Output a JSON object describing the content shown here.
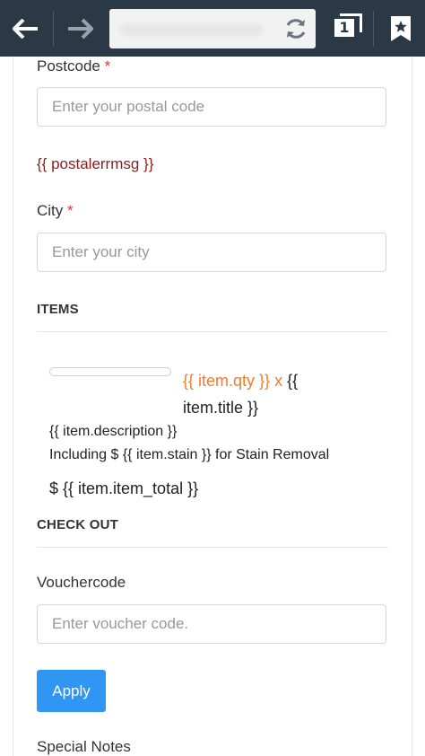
{
  "browser": {
    "tab_count": "1"
  },
  "form": {
    "postcode": {
      "label": "Postcode",
      "required_marker": "*",
      "placeholder": "Enter your postal code",
      "error": "{{ postalerrmsg }}"
    },
    "city": {
      "label": "City",
      "required_marker": "*",
      "placeholder": "Enter your city"
    }
  },
  "items_section": {
    "heading": "ITEMS",
    "item": {
      "qty_text": "{{ item.qty }} x",
      "title_open": "{{",
      "title_rest": "item.title }}",
      "description": "{{ item.description }}",
      "stain_line": "Including $ {{ item.stain }} for Stain Removal",
      "total": "$ {{ item.item_total }}"
    }
  },
  "checkout": {
    "heading": "CHECK OUT",
    "voucher_label": "Vouchercode",
    "voucher_placeholder": "Enter voucher code.",
    "apply_label": "Apply",
    "notes_label": "Special Notes"
  },
  "colors": {
    "topbar": "#2b3845",
    "accent_button": "#2f96f3",
    "qty_orange": "#f07c2d",
    "required_red": "#d9363e",
    "error_red": "#8b1c1c"
  }
}
